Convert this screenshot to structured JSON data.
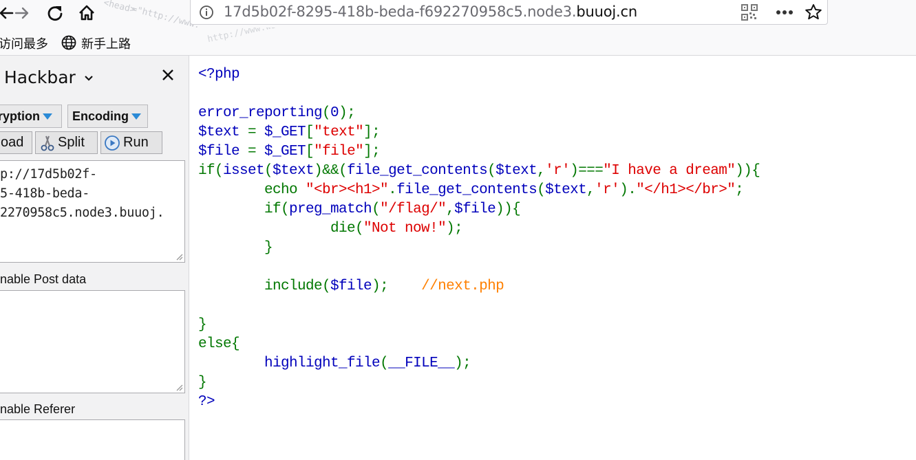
{
  "browser": {
    "url_prefix": "17d5b02f-8295-418b-beda-f692270958c5.node3.",
    "url_domain": "buuoj.cn",
    "bookmarks": [
      "访问最多",
      "新手上路"
    ],
    "icons": [
      "back-arrow-icon",
      "forward-arrow-icon",
      "reload-icon",
      "home-icon",
      "info-icon",
      "qr-code-icon",
      "more-dots-icon",
      "bookmark-star-icon",
      "globe-icon"
    ]
  },
  "hackbar": {
    "title": "Hackbar",
    "dropdowns": [
      "ryption",
      "Encoding"
    ],
    "buttons": [
      "oad",
      "Split",
      "Run"
    ],
    "url_value": "p://17d5b02f-\n5-418b-beda-\n2270958c5.node3.buuoj.",
    "post_label": "nable Post data",
    "referer_label": "nable Referer",
    "accent_color": "#2a8ad6"
  },
  "code_lines": [
    [
      [
        "df",
        "<?php"
      ]
    ],
    [],
    [
      [
        "df",
        "error_reporting"
      ],
      [
        "kw",
        "("
      ],
      [
        "df",
        "0"
      ],
      [
        "kw",
        ");"
      ]
    ],
    [
      [
        "df",
        "$text "
      ],
      [
        "kw",
        "= "
      ],
      [
        "df",
        "$_GET"
      ],
      [
        "kw",
        "["
      ],
      [
        "st",
        "\"text\""
      ],
      [
        "kw",
        "];"
      ]
    ],
    [
      [
        "df",
        "$file "
      ],
      [
        "kw",
        "= "
      ],
      [
        "df",
        "$_GET"
      ],
      [
        "kw",
        "["
      ],
      [
        "st",
        "\"file\""
      ],
      [
        "kw",
        "];"
      ]
    ],
    [
      [
        "kw",
        "if("
      ],
      [
        "df",
        "isset"
      ],
      [
        "kw",
        "("
      ],
      [
        "df",
        "$text"
      ],
      [
        "kw",
        ")&&("
      ],
      [
        "df",
        "file_get_contents"
      ],
      [
        "kw",
        "("
      ],
      [
        "df",
        "$text"
      ],
      [
        "kw",
        ","
      ],
      [
        "st",
        "'r'"
      ],
      [
        "kw",
        ")==="
      ],
      [
        "st",
        "\"I have a dream\""
      ],
      [
        "kw",
        ")){"
      ]
    ],
    [
      [
        "kw",
        "        echo "
      ],
      [
        "st",
        "\"<br><h1>\""
      ],
      [
        "kw",
        "."
      ],
      [
        "df",
        "file_get_contents"
      ],
      [
        "kw",
        "("
      ],
      [
        "df",
        "$text"
      ],
      [
        "kw",
        ","
      ],
      [
        "st",
        "'r'"
      ],
      [
        "kw",
        ")."
      ],
      [
        "st",
        "\"</h1></br>\""
      ],
      [
        "kw",
        ";"
      ]
    ],
    [
      [
        "kw",
        "        if("
      ],
      [
        "df",
        "preg_match"
      ],
      [
        "kw",
        "("
      ],
      [
        "st",
        "\"/flag/\""
      ],
      [
        "kw",
        ","
      ],
      [
        "df",
        "$file"
      ],
      [
        "kw",
        ")){"
      ]
    ],
    [
      [
        "kw",
        "                die("
      ],
      [
        "st",
        "\"Not now!\""
      ],
      [
        "kw",
        ");"
      ]
    ],
    [
      [
        "kw",
        "        }"
      ]
    ],
    [],
    [
      [
        "kw",
        "        include("
      ],
      [
        "df",
        "$file"
      ],
      [
        "kw",
        ");    "
      ],
      [
        "cm",
        "//next.php"
      ]
    ],
    [],
    [
      [
        "kw",
        "}"
      ]
    ],
    [
      [
        "kw",
        "else{"
      ]
    ],
    [
      [
        "kw",
        "        "
      ],
      [
        "df",
        "highlight_file"
      ],
      [
        "kw",
        "("
      ],
      [
        "df",
        "__FILE__"
      ],
      [
        "kw",
        ");"
      ]
    ],
    [
      [
        "kw",
        "}"
      ]
    ],
    [
      [
        "df",
        "?>"
      ]
    ]
  ]
}
